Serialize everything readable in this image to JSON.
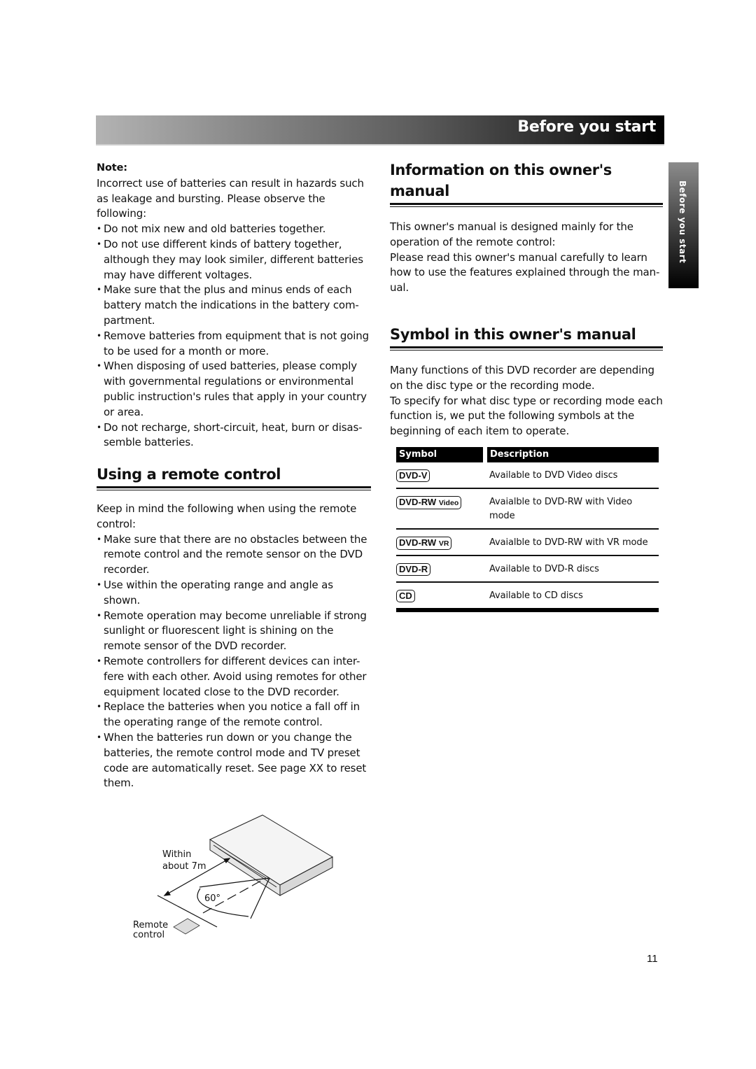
{
  "header": {
    "title": "Before you start"
  },
  "side_tab": {
    "label": "Before you start"
  },
  "note": {
    "label": "Note:",
    "intro": "Incorrect use of batteries can result in hazards such as leakage and bursting. Please observe the following:",
    "items": [
      "Do not mix new and old batteries together.",
      "Do not use different kinds of battery together, although they may look similer, different batteries may have different voltages.",
      "Make sure that the plus and minus ends of each battery match the indications in the battery com-partment.",
      "Remove batteries from equipment that is not going to be used for a month or more.",
      "When disposing of used batteries, please comply with governmental regulations or environmental public instruction's rules that apply in your country or area.",
      "Do not recharge, short-circuit, heat, burn or disas-semble batteries."
    ]
  },
  "remote_section": {
    "heading": "Using a remote control",
    "intro": "Keep in mind the following when using the remote control:",
    "items": [
      "Make sure that there are no obstacles between the remote control and the remote sensor on the DVD recorder.",
      "Use within the operating range and angle as shown.",
      "Remote operation may become unreliable if strong sunlight or fluorescent light is shining on the remote sensor of the DVD recorder.",
      "Remote controllers for different devices can inter-fere with each other. Avoid using remotes for other equipment located close to the DVD recorder.",
      "Replace the batteries when you notice a fall off in the operating range of the remote control.",
      "When the batteries run down or you change the batteries, the remote control mode and TV preset code are automatically reset. See page XX to reset them."
    ],
    "diagram": {
      "distance_label_1": "Within",
      "distance_label_2": "about 7m",
      "angle_label": "60°",
      "remote_label_1": "Remote",
      "remote_label_2": "control"
    }
  },
  "info_section": {
    "heading": "Information on this owner's manual",
    "paragraph_1": "This owner's manual is designed mainly for the operation of the remote control:",
    "paragraph_2": "Please read this owner's manual carefully to learn how to use the features explained through the man-ual."
  },
  "symbol_section": {
    "heading": "Symbol in this owner's manual",
    "paragraph_1": "Many functions of this DVD recorder are depending on the disc type or the recording mode.",
    "paragraph_2": "To specify for what disc type or recording mode each function is, we put the following symbols at the beginning of each item to operate.",
    "table": {
      "headers": [
        "Symbol",
        "Description"
      ],
      "rows": [
        {
          "symbol": "DVD-V",
          "suffix": "",
          "description": "Available to DVD Video discs"
        },
        {
          "symbol": "DVD-RW",
          "suffix": "Video",
          "description": "Avaialble to DVD-RW with Video mode"
        },
        {
          "symbol": "DVD-RW",
          "suffix": "VR",
          "description": "Avaialble to DVD-RW with VR mode"
        },
        {
          "symbol": "DVD-R",
          "suffix": "",
          "description": "Available to DVD-R discs"
        },
        {
          "symbol": "CD",
          "suffix": "",
          "description": "Available to CD discs"
        }
      ]
    }
  },
  "footer": {
    "page_number": "11"
  }
}
